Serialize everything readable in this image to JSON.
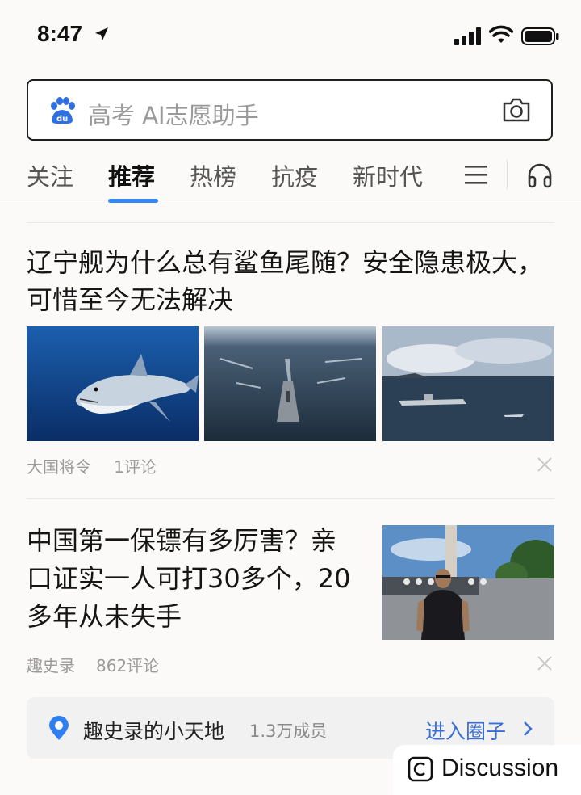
{
  "status_bar": {
    "time": "8:47",
    "icons": [
      "location-arrow-icon",
      "cellular-signal-icon",
      "wifi-icon",
      "battery-icon"
    ]
  },
  "search": {
    "placeholder": "高考 AI志愿助手",
    "logo_icon": "baidu-paw-icon",
    "camera_icon": "camera-icon"
  },
  "tabs": {
    "items": [
      {
        "label": "关注",
        "active": false
      },
      {
        "label": "推荐",
        "active": true
      },
      {
        "label": "热榜",
        "active": false
      },
      {
        "label": "抗疫",
        "active": false
      },
      {
        "label": "新时代",
        "active": false
      }
    ],
    "menu_icon": "hamburger-menu-icon",
    "audio_icon": "headphones-icon",
    "accent_color": "#3388ff"
  },
  "feed": [
    {
      "title": "辽宁舰为什么总有鲨鱼尾随？安全隐患极大，可惜至今无法解决",
      "images": [
        "shark-photo",
        "carrier-fleet-photo",
        "carrier-harbor-photo"
      ],
      "source": "大国将令",
      "comments": "1评论"
    },
    {
      "title": "中国第一保镖有多厉害？亲口证实一人可打30多个，20多年从未失手",
      "images": [
        "bodyguard-photo"
      ],
      "source": "趣史录",
      "comments": "862评论"
    }
  ],
  "circle": {
    "name": "趣史录的小天地",
    "members": "1.3万成员",
    "enter_label": "进入圈子",
    "link_color": "#3a6fd8"
  },
  "watermark": {
    "label": "Discussion"
  }
}
